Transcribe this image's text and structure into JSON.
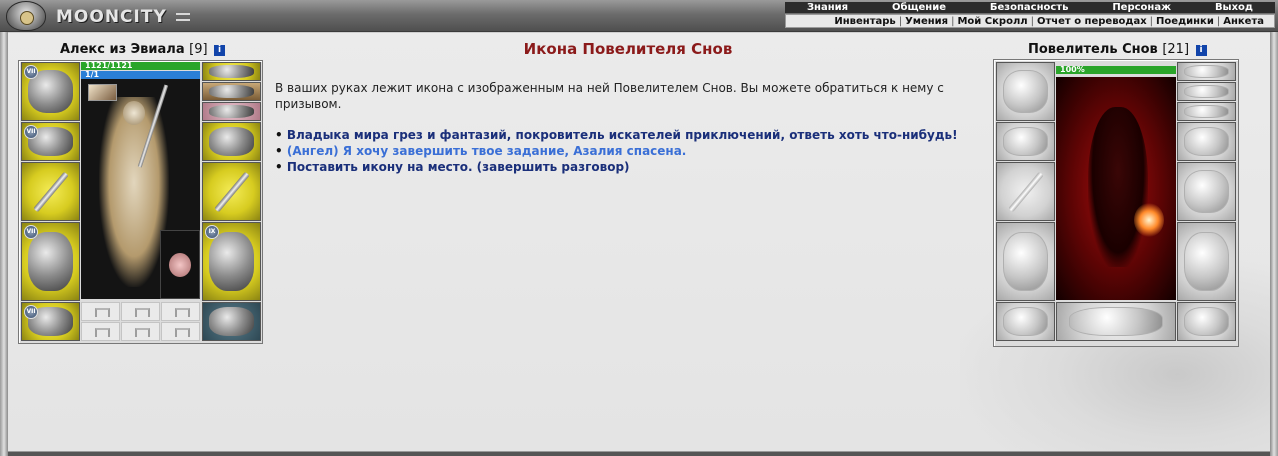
{
  "header": {
    "logo_text": "MOONCITY",
    "menu": [
      "Знания",
      "Общение",
      "Безопасность",
      "Персонаж",
      "Выход"
    ],
    "submenu": [
      "Инвентарь",
      "Умения",
      "Мой Скролл",
      "Отчет о переводах",
      "Поединки",
      "Анкета"
    ]
  },
  "player": {
    "name": "Алекс из Эвиала",
    "level": "[9]",
    "hp": "1121/1121",
    "hp_fraction": 1.0,
    "mana": "1/1",
    "mana_fraction": 1.0,
    "badges": [
      "VII",
      "VII",
      "VII",
      "IX",
      "VII"
    ]
  },
  "npc": {
    "name": "Повелитель Снов",
    "level": "[21]",
    "hp": "100%",
    "hp_fraction": 1.0
  },
  "quest": {
    "title": "Икона Повелителя Снов",
    "text": "В ваших руках лежит икона с изображенным на ней Повелителем Снов. Вы можете обратиться к нему с призывом.",
    "bullet": "•",
    "answers": [
      "Владыка мира грез и фантазий, покровитель искателей приключений, ответь хоть что-нибудь!",
      "(Ангел) Я хочу завершить твое задание, Азалия спасена.",
      "Поставить икону на место. (завершить разговор)"
    ]
  },
  "icons": {
    "info": "i",
    "info_name": "info-icon"
  },
  "colors": {
    "hp_bar": "#2aa52a",
    "mana_bar": "#2a7fd6",
    "quest_title": "#8b1a1a",
    "answer_link": "#1a2f7a",
    "answer_special": "#3a6fd6",
    "equip_slot": "#e0d530"
  }
}
